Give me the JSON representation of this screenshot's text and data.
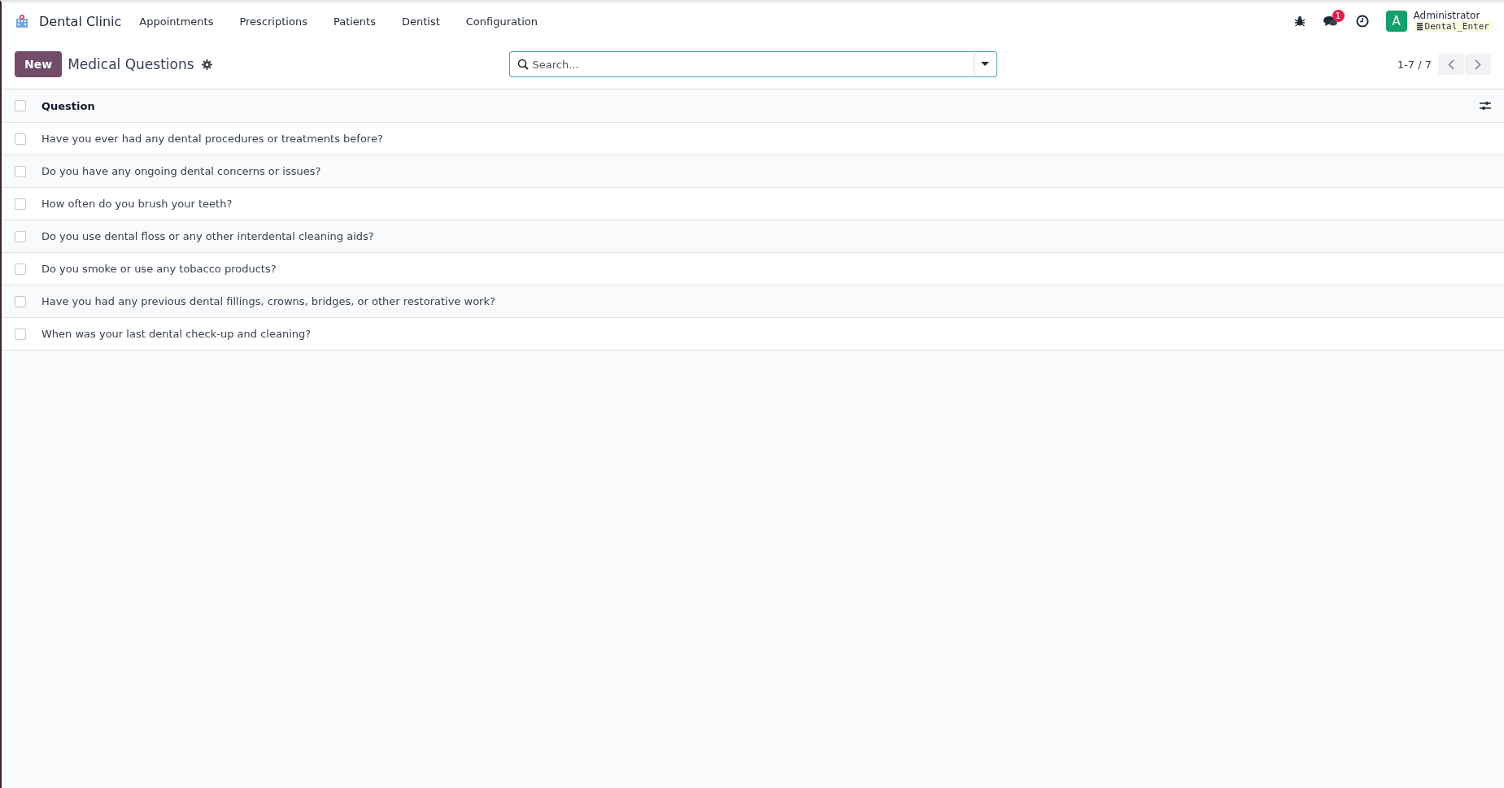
{
  "navbar": {
    "app_name": "Dental Clinic",
    "menu": [
      "Appointments",
      "Prescriptions",
      "Patients",
      "Dentist",
      "Configuration"
    ],
    "chat_badge": "1",
    "user": {
      "avatar_letter": "A",
      "name": "Administrator",
      "database": "Dental_Enter"
    }
  },
  "control_panel": {
    "new_button": "New",
    "title": "Medical Questions",
    "search": {
      "placeholder": "Search..."
    },
    "pager": "1-7 / 7"
  },
  "table": {
    "columns": [
      {
        "label": "Question",
        "checked": false
      }
    ],
    "rows": [
      {
        "question": "Have you ever had any dental procedures or treatments before?",
        "checked": false
      },
      {
        "question": "Do you have any ongoing dental concerns or issues?",
        "checked": false
      },
      {
        "question": "How often do you brush your teeth?",
        "checked": false
      },
      {
        "question": "Do you use dental floss or any other interdental cleaning aids?",
        "checked": false
      },
      {
        "question": "Do you smoke or use any tobacco products?",
        "checked": false
      },
      {
        "question": "Have you had any previous dental fillings, crowns, bridges, or other restorative work?",
        "checked": false
      },
      {
        "question": "When was your last dental check-up and cleaning?",
        "checked": false
      }
    ]
  }
}
